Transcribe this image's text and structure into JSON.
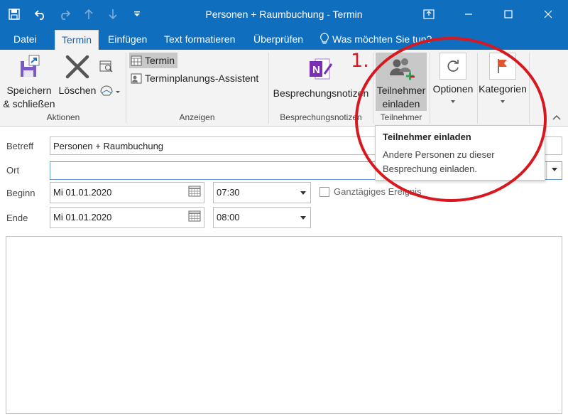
{
  "window": {
    "title": "Personen + Raumbuchung - Termin",
    "qat_icons": [
      "save-icon",
      "undo-icon",
      "redo-icon",
      "up-arrow-icon",
      "down-arrow-icon",
      "customize-qat-icon"
    ],
    "controls": [
      "restore-icon",
      "minimize-icon",
      "maximize-icon",
      "close-icon"
    ]
  },
  "tabs": [
    {
      "label": "Datei"
    },
    {
      "label": "Termin"
    },
    {
      "label": "Einfügen"
    },
    {
      "label": "Text formatieren"
    },
    {
      "label": "Überprüfen"
    }
  ],
  "tell_me": "Was möchten Sie tun?",
  "ribbon": {
    "aktionen": {
      "label": "Aktionen",
      "save_line1": "Speichern",
      "save_line2": "& schließen",
      "delete": "Löschen"
    },
    "anzeigen": {
      "label": "Anzeigen",
      "termin": "Termin",
      "assistent": "Terminplanungs-Assistent"
    },
    "besprechungsnotizen": {
      "label": "Besprechungsnotizen",
      "button": "Besprechungsnotizen"
    },
    "teilnehmer": {
      "label": "Teilnehmer",
      "invite_line1": "Teilnehmer",
      "invite_line2": "einladen"
    },
    "optionen": "Optionen",
    "kategorien": "Kategorien"
  },
  "form": {
    "betreff_label": "Betreff",
    "betreff_value": "Personen + Raumbuchung",
    "ort_label": "Ort",
    "ort_value": "",
    "beginn_label": "Beginn",
    "beginn_date": "Mi 01.01.2020",
    "beginn_time": "07:30",
    "ende_label": "Ende",
    "ende_date": "Mi 01.01.2020",
    "ende_time": "08:00",
    "allday_label": "Ganztägiges Ereignis"
  },
  "tooltip": {
    "title": "Teilnehmer einladen",
    "line1": "Andere Personen zu dieser",
    "line2": "Besprechung einladen."
  },
  "annotation": {
    "step": "1.",
    "color": "#d8181f"
  },
  "colors": {
    "titlebar": "#106ebe",
    "ribbon_bg": "#f3f3f3",
    "active_tab_text": "#1f5f9e"
  }
}
